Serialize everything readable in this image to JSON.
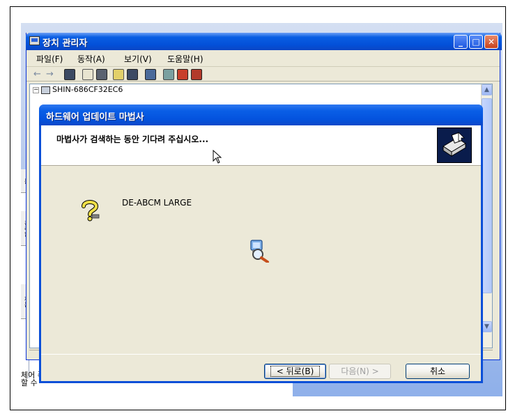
{
  "device_manager": {
    "title": "장치 관리자",
    "menu": [
      "파일(F)",
      "동작(A)",
      "보기(V)",
      "도움말(H)"
    ],
    "tree_root": "SHIN-686CF32EC6",
    "window_buttons": {
      "minimize": "_",
      "maximize": "□",
      "close": "✕"
    }
  },
  "wizard": {
    "title": "하드웨어 업데이트 마법사",
    "header_message": "마법사가 검색하는 동안 기다려 주십시오...",
    "device_name": "DE-ABCM LARGE",
    "buttons": {
      "back": "< 뒤로(B)",
      "next": "다음(N) >",
      "cancel": "취소"
    }
  },
  "background_text": {
    "left_tabs": [
      "름",
      "관리합",
      "제를"
    ],
    "bottom_lines": [
      "체어 폭",
      "할 수"
    ]
  },
  "colors": {
    "titlebar_blue": "#0453de",
    "dialog_face": "#ece9d8",
    "logo_bg": "#0a1c4c"
  },
  "icons": [
    "back-arrow-icon",
    "forward-arrow-icon",
    "properties-icon",
    "print-icon",
    "help-icon",
    "scan-icon",
    "uninstall-icon",
    "question-device-icon",
    "search-magnifier-icon",
    "hardware-wizard-logo-icon",
    "mouse-cursor-icon"
  ]
}
